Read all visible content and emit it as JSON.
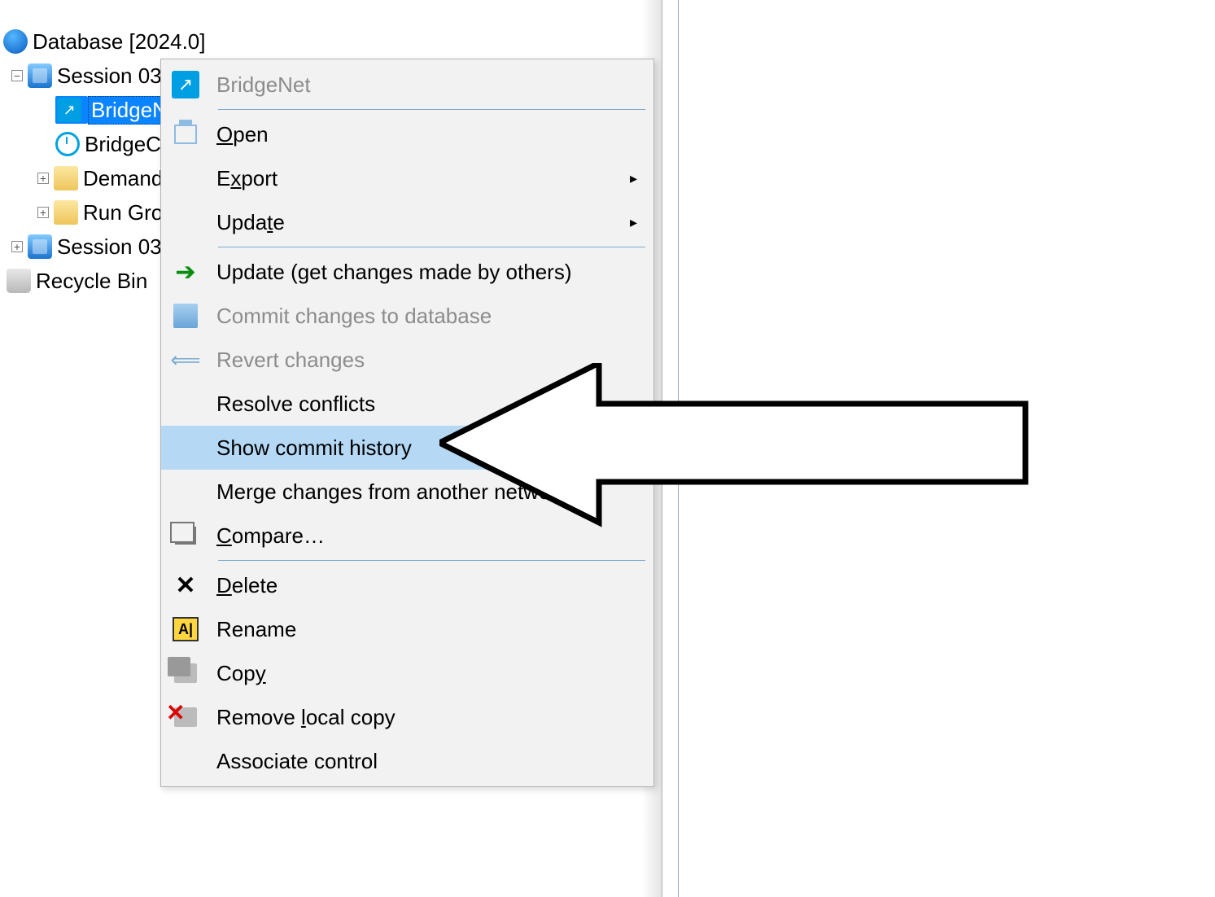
{
  "tree": {
    "root": "Database [2024.0]",
    "session_a": "Session 03",
    "bridgen": "BridgeN",
    "bridgec": "BridgeC",
    "demand": "Demand",
    "run_gro": "Run Gro",
    "session_b": "Session 03",
    "recycle": "Recycle Bin"
  },
  "menu": {
    "header": "BridgeNet",
    "open_pre": "O",
    "open_rest": "pen",
    "export_pre": "E",
    "export_rest": "xport",
    "update_pre": "Upda",
    "update_u": "t",
    "update_rest": "e",
    "update2": "Update (get changes made by others)",
    "commit": "Commit changes to database",
    "revert": "Revert changes",
    "resolve": "Resolve conflicts",
    "show_history": "Show commit history",
    "merge": "Merge changes from another network",
    "compare_pre": "C",
    "compare_rest": "ompare…",
    "delete_pre": "D",
    "delete_rest": "elete",
    "rename": "Rename",
    "copy_pre": "Cop",
    "copy_u": "y",
    "remove_pre": "Remove ",
    "remove_u": "l",
    "remove_rest": "ocal copy",
    "associate": "Associate control",
    "submenu_arrow": "▸"
  }
}
